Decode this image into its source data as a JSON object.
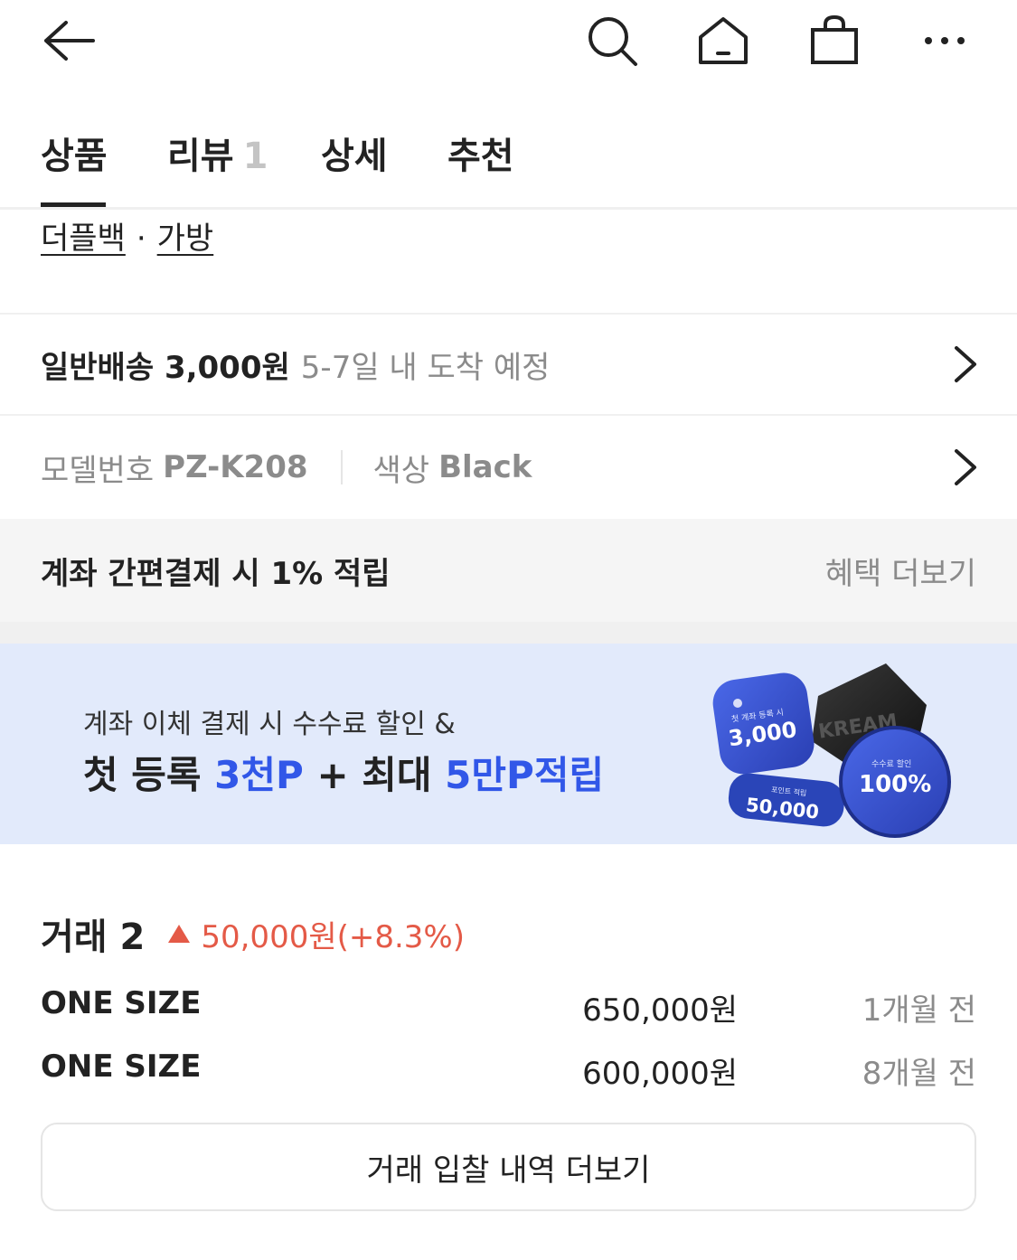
{
  "nav": {
    "back_icon": "arrow-left-icon",
    "search_icon": "search-icon",
    "home_icon": "home-icon",
    "bag_icon": "shopping-bag-icon",
    "more_icon": "more-horizontal-icon"
  },
  "tabs": [
    {
      "label": "상품",
      "count": "",
      "active": true
    },
    {
      "label": "리뷰",
      "count": "1",
      "active": false
    },
    {
      "label": "상세",
      "count": "",
      "active": false
    },
    {
      "label": "추천",
      "count": "",
      "active": false
    }
  ],
  "category": {
    "primary": "더플백",
    "separator": "·",
    "secondary": "가방"
  },
  "shipping": {
    "label": "일반배송 3,000원",
    "eta": "5-7일 내 도착 예정"
  },
  "model": {
    "model_label": "모델번호",
    "model_value": "PZ-K208",
    "color_label": "색상",
    "color_value": "Black"
  },
  "benefit": {
    "title": "계좌 간편결제 시 1% 적립",
    "more": "혜택 더보기"
  },
  "banner": {
    "subtitle": "계좌 이체 결제 시 수수료 할인 &",
    "headline_prefix": "첫 등록 ",
    "headline_blue1": "3천P",
    "headline_mid": " + 최대 ",
    "headline_blue2": "5만P적립",
    "coin1_small": "첫 계좌 등록 시",
    "coin1_big": "3,000",
    "coin2_small": "포인트 적립",
    "coin2_big": "50,000",
    "coin3_small": "수수료 할인",
    "coin3_big": "100%",
    "coin4_text": "KREAM",
    "accent": "#3157e8",
    "background": "#e2eafb"
  },
  "trades": {
    "title": "거래 2",
    "change": "50,000원(+8.3%)",
    "change_color": "#e45a47",
    "rows": [
      {
        "size": "ONE SIZE",
        "price": "650,000원",
        "when": "1개월 전"
      },
      {
        "size": "ONE SIZE",
        "price": "600,000원",
        "when": "8개월 전"
      }
    ],
    "more_button": "거래 입찰 내역 더보기"
  }
}
